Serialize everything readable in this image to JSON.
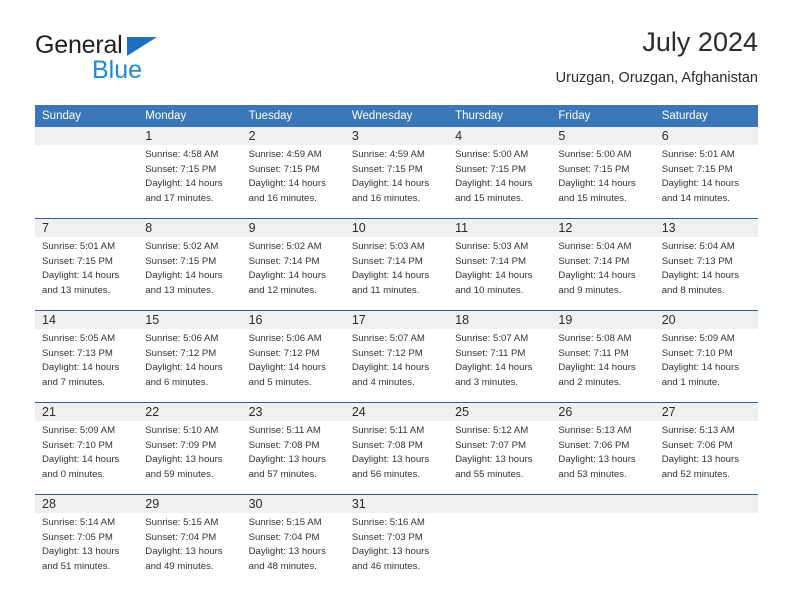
{
  "logo": {
    "word1": "General",
    "word2": "Blue",
    "triangle_color": "#1e72bd",
    "word2_color": "#1e8ad6"
  },
  "header": {
    "title": "July 2024",
    "subtitle": "Uruzgan, Oruzgan, Afghanistan"
  },
  "theme": {
    "header_blue": "#3b76b8",
    "separator_blue": "#2f5f99",
    "daynum_band": "#f0f0f0",
    "text": "#333333"
  },
  "weekday_headers": [
    "Sunday",
    "Monday",
    "Tuesday",
    "Wednesday",
    "Thursday",
    "Friday",
    "Saturday"
  ],
  "weeks": [
    {
      "days": [
        {
          "num": "",
          "sunrise": "",
          "sunset": "",
          "daylight1": "",
          "daylight2": ""
        },
        {
          "num": "1",
          "sunrise": "Sunrise: 4:58 AM",
          "sunset": "Sunset: 7:15 PM",
          "daylight1": "Daylight: 14 hours",
          "daylight2": "and 17 minutes."
        },
        {
          "num": "2",
          "sunrise": "Sunrise: 4:59 AM",
          "sunset": "Sunset: 7:15 PM",
          "daylight1": "Daylight: 14 hours",
          "daylight2": "and 16 minutes."
        },
        {
          "num": "3",
          "sunrise": "Sunrise: 4:59 AM",
          "sunset": "Sunset: 7:15 PM",
          "daylight1": "Daylight: 14 hours",
          "daylight2": "and 16 minutes."
        },
        {
          "num": "4",
          "sunrise": "Sunrise: 5:00 AM",
          "sunset": "Sunset: 7:15 PM",
          "daylight1": "Daylight: 14 hours",
          "daylight2": "and 15 minutes."
        },
        {
          "num": "5",
          "sunrise": "Sunrise: 5:00 AM",
          "sunset": "Sunset: 7:15 PM",
          "daylight1": "Daylight: 14 hours",
          "daylight2": "and 15 minutes."
        },
        {
          "num": "6",
          "sunrise": "Sunrise: 5:01 AM",
          "sunset": "Sunset: 7:15 PM",
          "daylight1": "Daylight: 14 hours",
          "daylight2": "and 14 minutes."
        }
      ]
    },
    {
      "days": [
        {
          "num": "7",
          "sunrise": "Sunrise: 5:01 AM",
          "sunset": "Sunset: 7:15 PM",
          "daylight1": "Daylight: 14 hours",
          "daylight2": "and 13 minutes."
        },
        {
          "num": "8",
          "sunrise": "Sunrise: 5:02 AM",
          "sunset": "Sunset: 7:15 PM",
          "daylight1": "Daylight: 14 hours",
          "daylight2": "and 13 minutes."
        },
        {
          "num": "9",
          "sunrise": "Sunrise: 5:02 AM",
          "sunset": "Sunset: 7:14 PM",
          "daylight1": "Daylight: 14 hours",
          "daylight2": "and 12 minutes."
        },
        {
          "num": "10",
          "sunrise": "Sunrise: 5:03 AM",
          "sunset": "Sunset: 7:14 PM",
          "daylight1": "Daylight: 14 hours",
          "daylight2": "and 11 minutes."
        },
        {
          "num": "11",
          "sunrise": "Sunrise: 5:03 AM",
          "sunset": "Sunset: 7:14 PM",
          "daylight1": "Daylight: 14 hours",
          "daylight2": "and 10 minutes."
        },
        {
          "num": "12",
          "sunrise": "Sunrise: 5:04 AM",
          "sunset": "Sunset: 7:14 PM",
          "daylight1": "Daylight: 14 hours",
          "daylight2": "and 9 minutes."
        },
        {
          "num": "13",
          "sunrise": "Sunrise: 5:04 AM",
          "sunset": "Sunset: 7:13 PM",
          "daylight1": "Daylight: 14 hours",
          "daylight2": "and 8 minutes."
        }
      ]
    },
    {
      "days": [
        {
          "num": "14",
          "sunrise": "Sunrise: 5:05 AM",
          "sunset": "Sunset: 7:13 PM",
          "daylight1": "Daylight: 14 hours",
          "daylight2": "and 7 minutes."
        },
        {
          "num": "15",
          "sunrise": "Sunrise: 5:06 AM",
          "sunset": "Sunset: 7:12 PM",
          "daylight1": "Daylight: 14 hours",
          "daylight2": "and 6 minutes."
        },
        {
          "num": "16",
          "sunrise": "Sunrise: 5:06 AM",
          "sunset": "Sunset: 7:12 PM",
          "daylight1": "Daylight: 14 hours",
          "daylight2": "and 5 minutes."
        },
        {
          "num": "17",
          "sunrise": "Sunrise: 5:07 AM",
          "sunset": "Sunset: 7:12 PM",
          "daylight1": "Daylight: 14 hours",
          "daylight2": "and 4 minutes."
        },
        {
          "num": "18",
          "sunrise": "Sunrise: 5:07 AM",
          "sunset": "Sunset: 7:11 PM",
          "daylight1": "Daylight: 14 hours",
          "daylight2": "and 3 minutes."
        },
        {
          "num": "19",
          "sunrise": "Sunrise: 5:08 AM",
          "sunset": "Sunset: 7:11 PM",
          "daylight1": "Daylight: 14 hours",
          "daylight2": "and 2 minutes."
        },
        {
          "num": "20",
          "sunrise": "Sunrise: 5:09 AM",
          "sunset": "Sunset: 7:10 PM",
          "daylight1": "Daylight: 14 hours",
          "daylight2": "and 1 minute."
        }
      ]
    },
    {
      "days": [
        {
          "num": "21",
          "sunrise": "Sunrise: 5:09 AM",
          "sunset": "Sunset: 7:10 PM",
          "daylight1": "Daylight: 14 hours",
          "daylight2": "and 0 minutes."
        },
        {
          "num": "22",
          "sunrise": "Sunrise: 5:10 AM",
          "sunset": "Sunset: 7:09 PM",
          "daylight1": "Daylight: 13 hours",
          "daylight2": "and 59 minutes."
        },
        {
          "num": "23",
          "sunrise": "Sunrise: 5:11 AM",
          "sunset": "Sunset: 7:08 PM",
          "daylight1": "Daylight: 13 hours",
          "daylight2": "and 57 minutes."
        },
        {
          "num": "24",
          "sunrise": "Sunrise: 5:11 AM",
          "sunset": "Sunset: 7:08 PM",
          "daylight1": "Daylight: 13 hours",
          "daylight2": "and 56 minutes."
        },
        {
          "num": "25",
          "sunrise": "Sunrise: 5:12 AM",
          "sunset": "Sunset: 7:07 PM",
          "daylight1": "Daylight: 13 hours",
          "daylight2": "and 55 minutes."
        },
        {
          "num": "26",
          "sunrise": "Sunrise: 5:13 AM",
          "sunset": "Sunset: 7:06 PM",
          "daylight1": "Daylight: 13 hours",
          "daylight2": "and 53 minutes."
        },
        {
          "num": "27",
          "sunrise": "Sunrise: 5:13 AM",
          "sunset": "Sunset: 7:06 PM",
          "daylight1": "Daylight: 13 hours",
          "daylight2": "and 52 minutes."
        }
      ]
    },
    {
      "days": [
        {
          "num": "28",
          "sunrise": "Sunrise: 5:14 AM",
          "sunset": "Sunset: 7:05 PM",
          "daylight1": "Daylight: 13 hours",
          "daylight2": "and 51 minutes."
        },
        {
          "num": "29",
          "sunrise": "Sunrise: 5:15 AM",
          "sunset": "Sunset: 7:04 PM",
          "daylight1": "Daylight: 13 hours",
          "daylight2": "and 49 minutes."
        },
        {
          "num": "30",
          "sunrise": "Sunrise: 5:15 AM",
          "sunset": "Sunset: 7:04 PM",
          "daylight1": "Daylight: 13 hours",
          "daylight2": "and 48 minutes."
        },
        {
          "num": "31",
          "sunrise": "Sunrise: 5:16 AM",
          "sunset": "Sunset: 7:03 PM",
          "daylight1": "Daylight: 13 hours",
          "daylight2": "and 46 minutes."
        },
        {
          "num": "",
          "sunrise": "",
          "sunset": "",
          "daylight1": "",
          "daylight2": ""
        },
        {
          "num": "",
          "sunrise": "",
          "sunset": "",
          "daylight1": "",
          "daylight2": ""
        },
        {
          "num": "",
          "sunrise": "",
          "sunset": "",
          "daylight1": "",
          "daylight2": ""
        }
      ]
    }
  ]
}
